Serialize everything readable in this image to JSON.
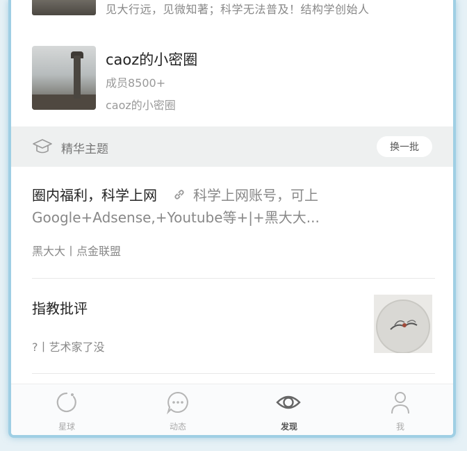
{
  "top_item": {
    "description": "见大行远，见微知著；科学无法普及！结构学创始人"
  },
  "circle": {
    "title": "caoz的小密圈",
    "members": "成员8500+",
    "description": "caoz的小密圈"
  },
  "section": {
    "title": "精华主题",
    "refresh_label": "换一批"
  },
  "posts": [
    {
      "title": "圈内福利，科学上网",
      "excerpt_line1": "科学上网账号，可上",
      "excerpt_line2": "Google+Adsense,+Youtube等+|+黑大大...",
      "meta": "黑大大丨点金联盟"
    },
    {
      "title": "指教批评",
      "meta": "?丨艺术家了没"
    }
  ],
  "nav": {
    "items": [
      {
        "label": "星球",
        "icon": "planet-icon"
      },
      {
        "label": "动态",
        "icon": "chat-icon"
      },
      {
        "label": "发现",
        "icon": "eye-icon",
        "active": true
      },
      {
        "label": "我",
        "icon": "person-icon"
      }
    ]
  },
  "colors": {
    "frame_border": "#9fcfe4",
    "section_bg": "#eef0f0",
    "primary_text": "#222222",
    "secondary_text": "#888888"
  }
}
